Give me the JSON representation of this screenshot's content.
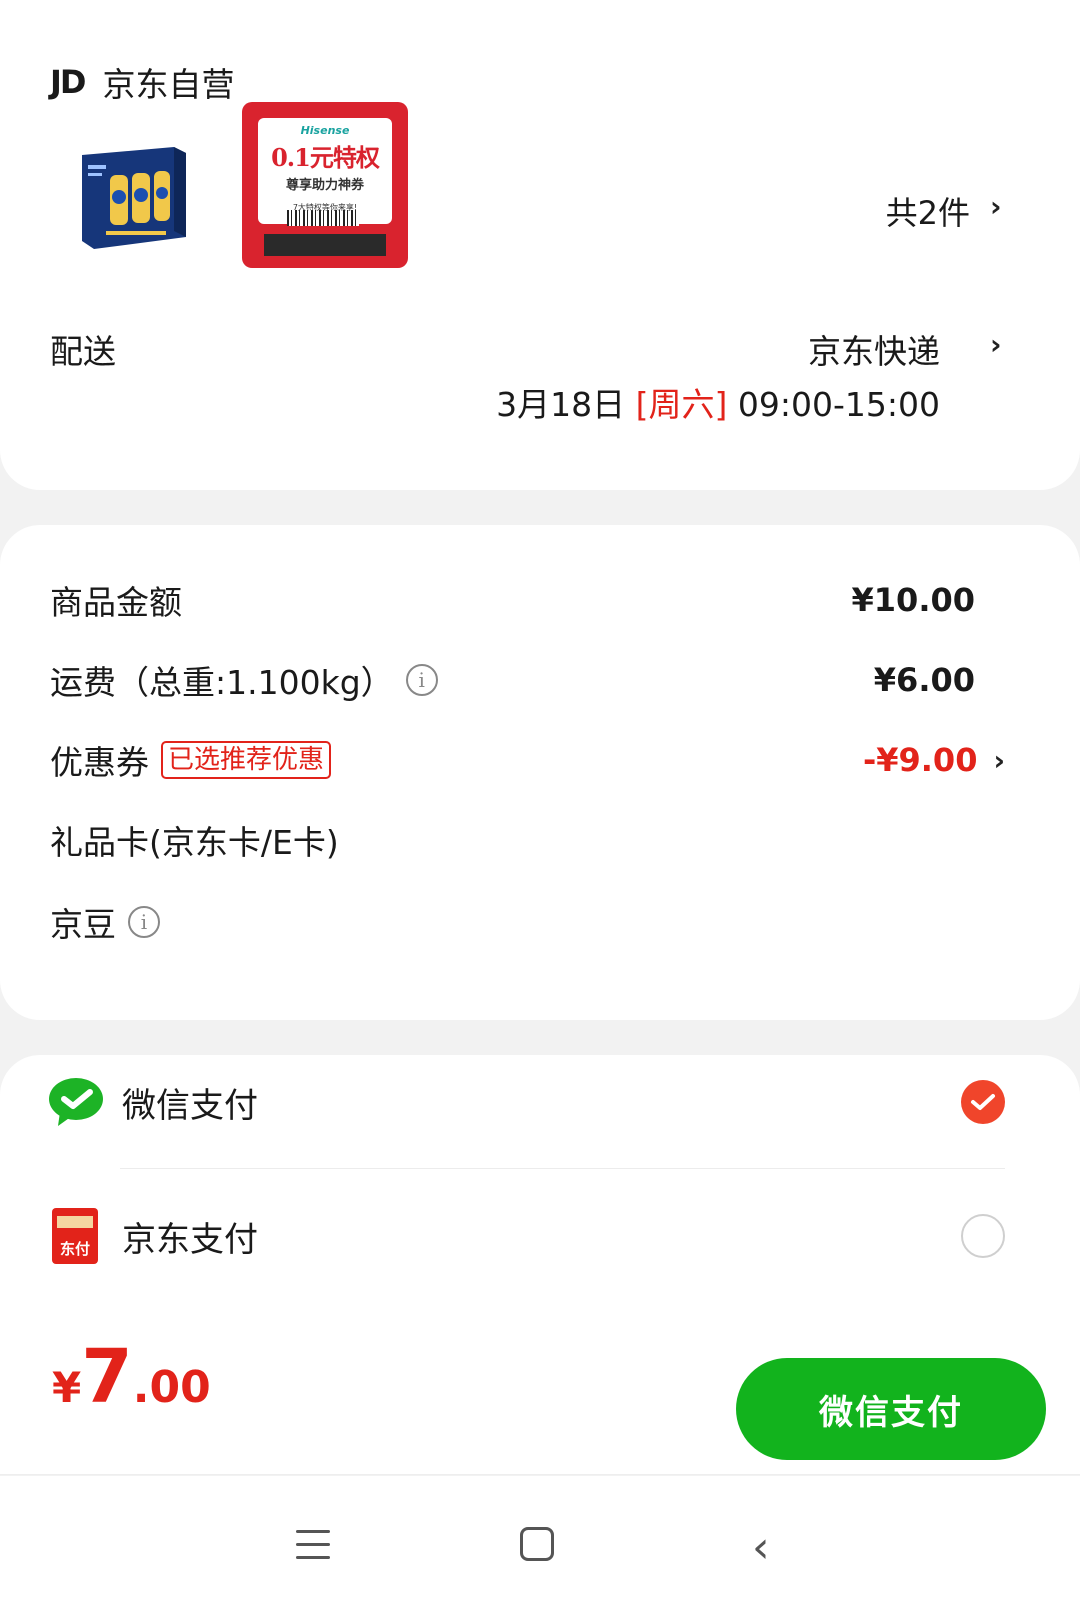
{
  "store": {
    "logo_text": "JD",
    "name": "京东自营"
  },
  "products": {
    "item2_card": {
      "brand": "Hisense",
      "headline": "0.1元特权",
      "subline": "尊享助力神券",
      "note": "7大特权等你来享!"
    },
    "count_label": "共2件"
  },
  "delivery": {
    "label": "配送",
    "method": "京东快递",
    "date": "3月18日",
    "weekday": "[周六]",
    "time": "09:00-15:00"
  },
  "price": {
    "goods_label": "商品金额",
    "goods_value": "¥10.00",
    "freight_label": "运费（总重:1.100kg）",
    "freight_value": "¥6.00",
    "coupon_label": "优惠券",
    "coupon_tag": "已选推荐优惠",
    "coupon_value": "-¥9.00",
    "giftcard_label": "礼品卡(京东卡/E卡)",
    "jingdou_label": "京豆"
  },
  "payment": {
    "options": [
      {
        "name": "微信支付",
        "selected": true,
        "icon": "wechat-pay-icon"
      },
      {
        "name": "京东支付",
        "selected": false,
        "icon": "jd-pay-icon",
        "icon_text": "东付"
      }
    ]
  },
  "footer": {
    "currency": "¥",
    "total_int": "7",
    "total_dec": ".00",
    "pay_button": "微信支付"
  },
  "colors": {
    "accent_red": "#e2231a",
    "wechat_green": "#12b31d",
    "radio_selected": "#f0452b"
  }
}
